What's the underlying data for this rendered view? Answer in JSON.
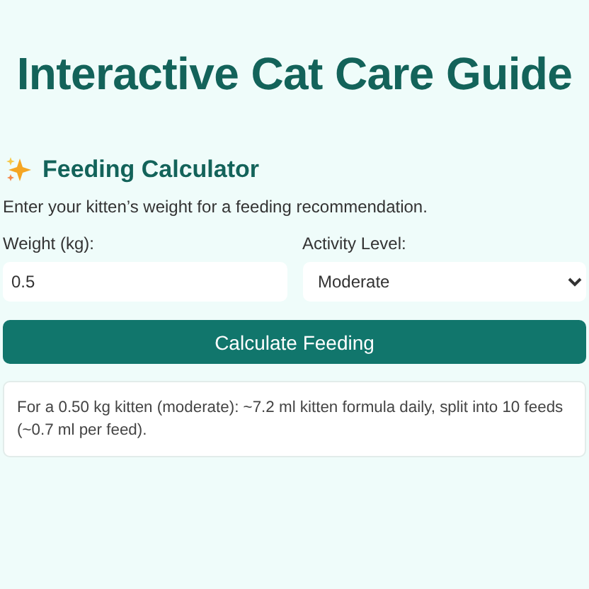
{
  "title": "Interactive Cat Care Guide",
  "section": {
    "heading": "Feeding Calculator",
    "description": "Enter your kitten’s weight for a feeding recommendation."
  },
  "form": {
    "weight": {
      "label": "Weight (kg):",
      "value": "0.5"
    },
    "activity": {
      "label": "Activity Level:",
      "value": "Moderate"
    }
  },
  "button": "Calculate Feeding",
  "result": "For a 0.50 kg kitten (moderate): ~7.2 ml kitten formula daily, split into 10 feeds (~0.7 ml per feed)."
}
